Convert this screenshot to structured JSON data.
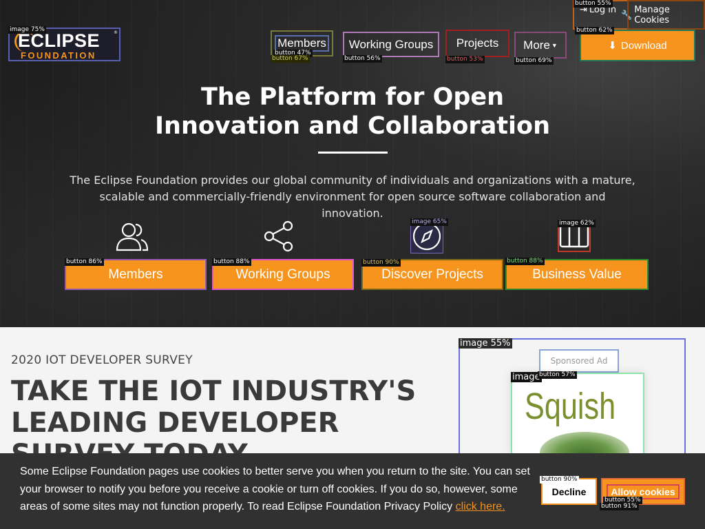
{
  "header": {
    "logo_top": "ECLIPSE",
    "logo_bottom": "FOUNDATION",
    "login_label": "Log in",
    "manage_cookies_label": "Manage Cookies",
    "nav": [
      {
        "label": "Members"
      },
      {
        "label": "Working Groups"
      },
      {
        "label": "Projects"
      },
      {
        "label": "More"
      }
    ],
    "download_label": "Download"
  },
  "hero": {
    "headline_line1": "The Platform for Open",
    "headline_line2": "Innovation and Collaboration",
    "lede": "The Eclipse Foundation provides our global community of individuals and organizations with a mature, scalable and commercially-friendly environment for open source software collaboration and innovation.",
    "ctas": [
      {
        "label": "Members",
        "icon": "people-icon"
      },
      {
        "label": "Working Groups",
        "icon": "share-icon"
      },
      {
        "label": "Discover Projects",
        "icon": "compass-icon"
      },
      {
        "label": "Business Value",
        "icon": "columns-icon"
      }
    ]
  },
  "promo": {
    "kicker": "2020 IOT DEVELOPER SURVEY",
    "title": "TAKE THE IOT INDUSTRY'S LEADING DEVELOPER SURVEY TODAY",
    "sponsored_label": "Sponsored Ad",
    "ad_word": "Squish"
  },
  "cookie": {
    "text": "Some Eclipse Foundation pages use cookies to better serve you when you return to the site. You can set your browser to notify you before you receive a cookie or turn off cookies. If you do so, however, some areas of some sites may not function properly. To read Eclipse Foundation Privacy Policy",
    "link_label": "click here.",
    "decline_label": "Decline",
    "allow_label": "Allow cookies"
  },
  "annotations": [
    "image 75%",
    "button 47%",
    "button 67%",
    "button 56%",
    "button 53%",
    "button 69%",
    "button 55%",
    "button 62%",
    "button 86%",
    "button 88%",
    "button 90%",
    "button 88%",
    "image 65%",
    "image 62%",
    "image 55%",
    "image",
    "button 57%",
    "button 90%",
    "button 55%",
    "button 91%"
  ],
  "colors": {
    "accent": "#f7941e",
    "hero_bg": "#262626",
    "cookie_bg": "#313131",
    "page_bg": "#f4f4f4"
  }
}
